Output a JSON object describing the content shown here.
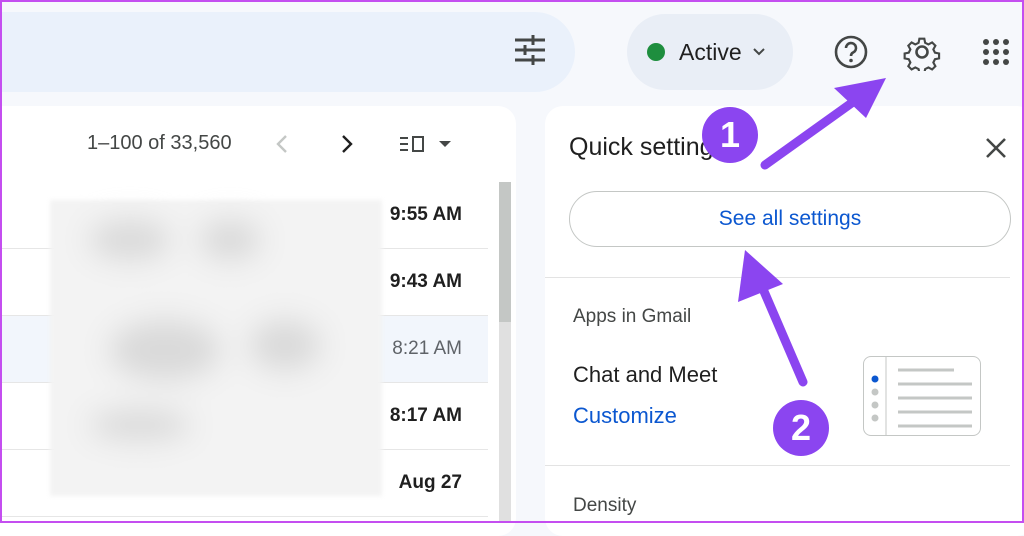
{
  "toolbar": {
    "filter_icon": "tune-icon",
    "status_label": "Active",
    "status_color": "#1e8e3e",
    "help_icon": "help-icon",
    "settings_icon": "gear-icon",
    "apps_icon": "apps-grid-icon"
  },
  "mail": {
    "pagination": "1–100 of 33,560",
    "rows": [
      {
        "time": "9:55 AM",
        "unread": true
      },
      {
        "time": "9:43 AM",
        "unread": true
      },
      {
        "time": "8:21 AM",
        "unread": false
      },
      {
        "time": "8:17 AM",
        "unread": true
      },
      {
        "time": "Aug 27",
        "unread": true
      }
    ]
  },
  "quick_settings": {
    "title": "Quick settings",
    "see_all": "See all settings",
    "apps_section": "Apps in Gmail",
    "chat_label": "Chat and Meet",
    "customize": "Customize",
    "density_section": "Density"
  },
  "annotations": {
    "badge_1": "1",
    "badge_2": "2",
    "arrow_color": "#8b45f0"
  }
}
